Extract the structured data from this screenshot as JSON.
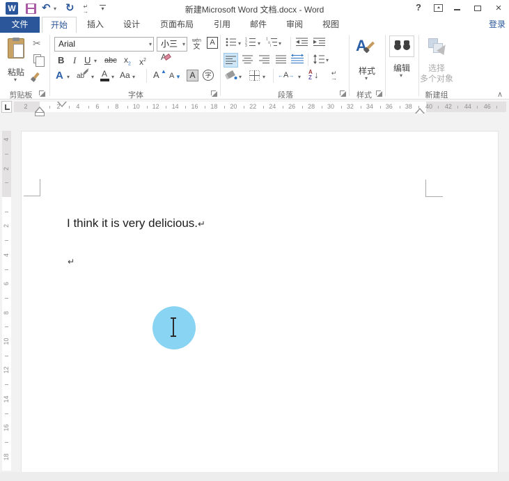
{
  "titlebar": {
    "title": "新建Microsoft Word 文档.docx - Word",
    "help": "?"
  },
  "icons": {
    "undo": "↶",
    "redo": "↻",
    "dropdown": "▾",
    "close": "×",
    "collapse": "∧",
    "arrow_down": "↓",
    "arrow_left": "←",
    "arrow_right": "→",
    "mark_return": "↵",
    "mark_arrow": "→",
    "logo_w": "W"
  },
  "tabs": {
    "file": "文件",
    "items": [
      {
        "label": "开始",
        "active": true
      },
      {
        "label": "插入",
        "active": false
      },
      {
        "label": "设计",
        "active": false
      },
      {
        "label": "页面布局",
        "active": false
      },
      {
        "label": "引用",
        "active": false
      },
      {
        "label": "邮件",
        "active": false
      },
      {
        "label": "审阅",
        "active": false
      },
      {
        "label": "视图",
        "active": false
      }
    ],
    "sign_in": "登录"
  },
  "ribbon": {
    "clipboard": {
      "paste": "粘贴",
      "label": "剪贴板"
    },
    "font": {
      "family": "Arial",
      "size": "小三",
      "bold": "B",
      "italic": "I",
      "underline": "U",
      "strike": "abc",
      "x": "x",
      "two": "2",
      "phonetic_top": "wén",
      "phonetic_bottom": "文",
      "border_a": "A",
      "effects_a": "A",
      "highlight_ab": "ab",
      "color_a": "A",
      "case_aa": "Aa",
      "grow_a": "A",
      "shrink_a": "A",
      "shade_a": "A",
      "circle_char": "字",
      "clear_a": "A",
      "label": "字体"
    },
    "paragraph": {
      "cn_a": "A",
      "sort_a": "A",
      "sort_z": "Z",
      "label": "段落"
    },
    "styles": {
      "button": "样式",
      "icon_a": "A",
      "label": "样式"
    },
    "editing": {
      "button": "编辑"
    },
    "newgroup": {
      "line1": "选择",
      "line2": "多个对象",
      "label": "新建组"
    }
  },
  "ruler": {
    "h_margin_left": [
      "2"
    ],
    "h_units": [
      "2",
      "4",
      "6",
      "8",
      "10",
      "12",
      "14",
      "16",
      "18",
      "20",
      "22",
      "24",
      "26",
      "28",
      "30",
      "32",
      "34",
      "36",
      "38"
    ],
    "h_margin_right": [
      "40",
      "42",
      "44",
      "46"
    ],
    "v_margin_top": [
      "4",
      "2"
    ],
    "v_units": [
      "2",
      "4",
      "6",
      "8",
      "10",
      "12",
      "14",
      "16",
      "18"
    ]
  },
  "document": {
    "line1": "I think it is very delicious.",
    "pilcrow": "↵",
    "empty_pilcrow": "↵"
  },
  "colors": {
    "accent_blue": "#2b579a",
    "save_purple": "#a95ba5",
    "touch_circle": "#68c6f0",
    "highlight_bg": "#cde6f7"
  }
}
